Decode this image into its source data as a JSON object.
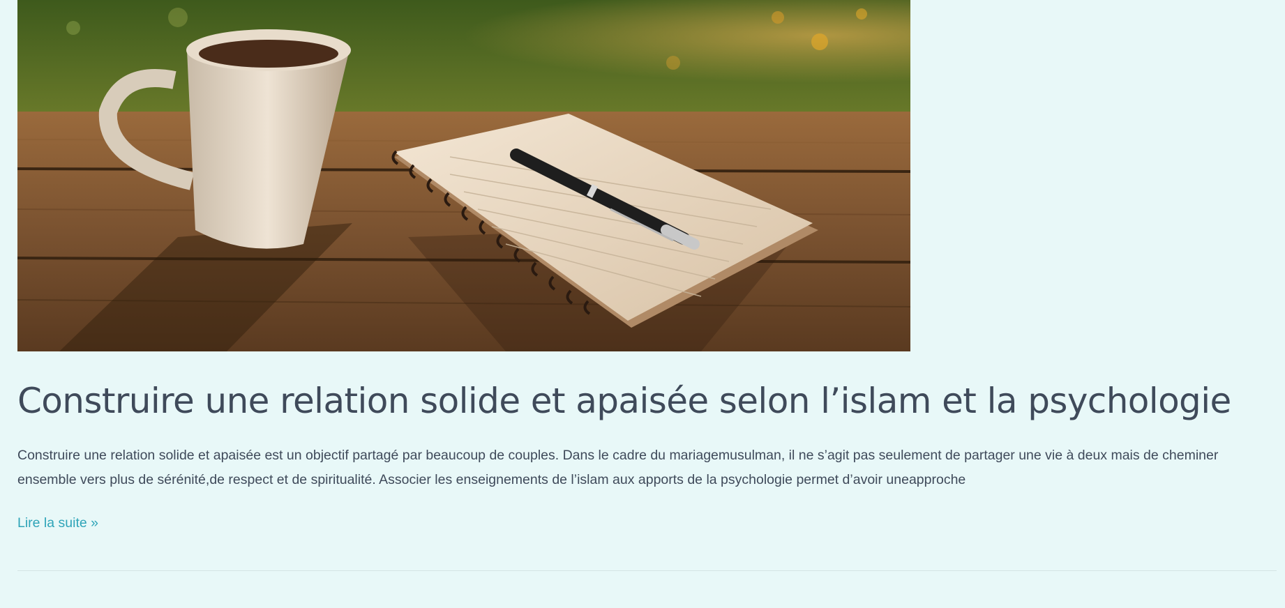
{
  "post": {
    "image_alt": "Mug de café et carnet à spirale avec stylo sur une table en bois",
    "title": "Construire une relation solide et apaisée selon l’islam et la psychologie",
    "excerpt": "Construire une relation solide et apaisée est un objectif partagé par beaucoup de couples. Dans le cadre du mariagemusulman, il ne s’agit pas seulement de partager une vie à deux mais de cheminer ensemble vers plus de sérénité,de respect et de spiritualité. Associer les enseignements de l’islam aux apports de la psychologie permet d’avoir uneapproche",
    "read_more": "Lire la suite »"
  },
  "colors": {
    "background": "#e8f8f8",
    "title": "#3f4a5a",
    "text": "#3f4a5a",
    "link": "#2ea4b8",
    "divider": "#d4e3e4"
  }
}
